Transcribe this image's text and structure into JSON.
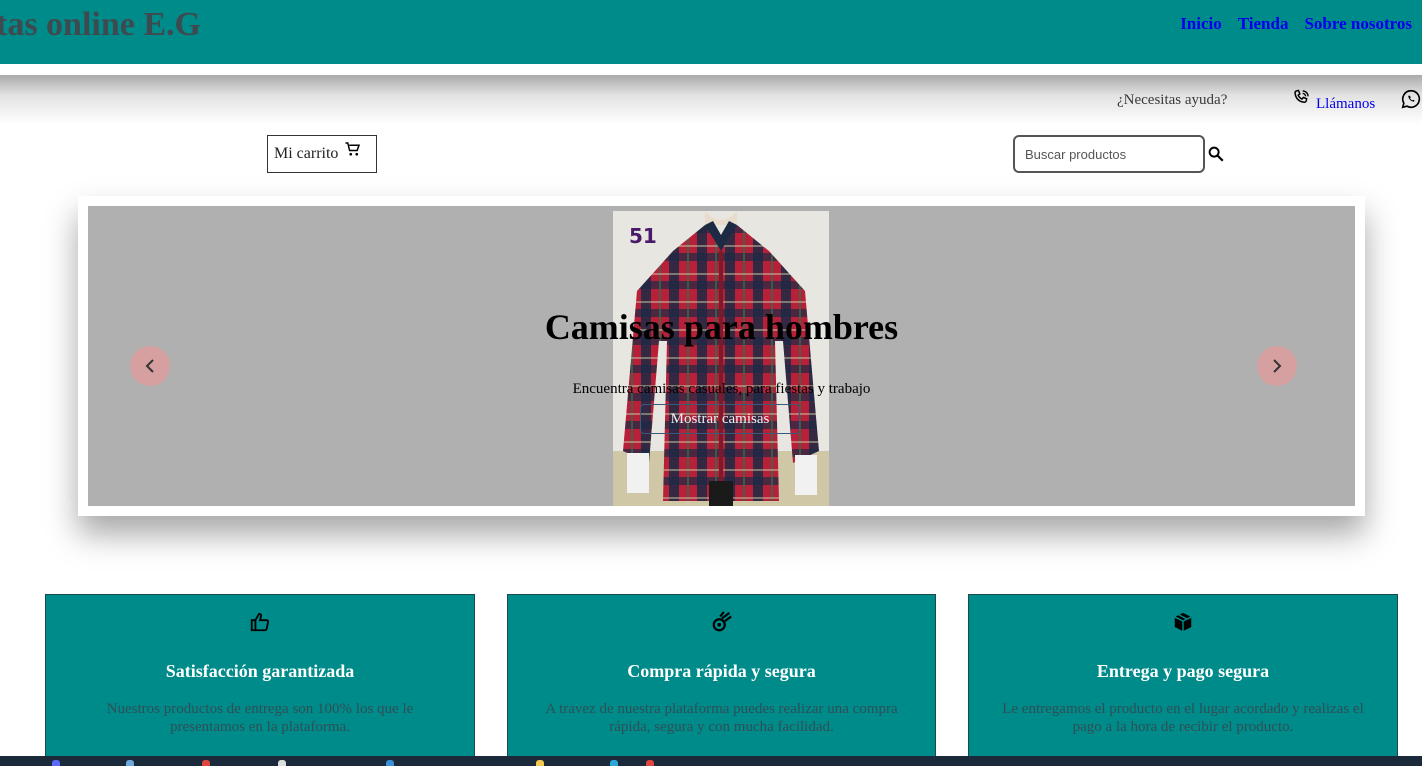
{
  "header": {
    "brand": "tas online E.G",
    "nav": [
      "Inicio",
      "Tienda",
      "Sobre nosotros"
    ]
  },
  "help": {
    "question": "¿Necesitas ayuda?",
    "call_label": "Llámanos",
    "phone_icon": "phone-icon",
    "whatsapp_icon": "whatsapp-icon"
  },
  "cart": {
    "label": "Mi carrito",
    "icon": "cart-icon"
  },
  "search": {
    "placeholder": "Buscar productos",
    "value": ""
  },
  "carousel": {
    "title": "Camisas para hombres",
    "subtitle": "Encuentra camisas casuales, para fiestas y trabajo",
    "button": "Mostrar camisas",
    "image_tag": "51"
  },
  "features": [
    {
      "icon": "thumbs-up-icon",
      "title": "Satisfacción garantizada",
      "text": "Nuestros productos de entrega son 100% los que le presentamos en la plataforma."
    },
    {
      "icon": "meteor-icon",
      "title": "Compra rápida y segura",
      "text": "A travez de nuestra plataforma puedes realizar una compra rápida, segura y con mucha facilidad."
    },
    {
      "icon": "box-icon",
      "title": "Entrega y pago segura",
      "text": "Le entregamos el producto en el lugar acordado y realizas el pago a la hora de recibir el producto."
    }
  ],
  "colors": {
    "primary": "#008b8b",
    "link": "#0000ee",
    "slide_bg": "#b0b0b0",
    "arrow": "#d6a0a0"
  }
}
